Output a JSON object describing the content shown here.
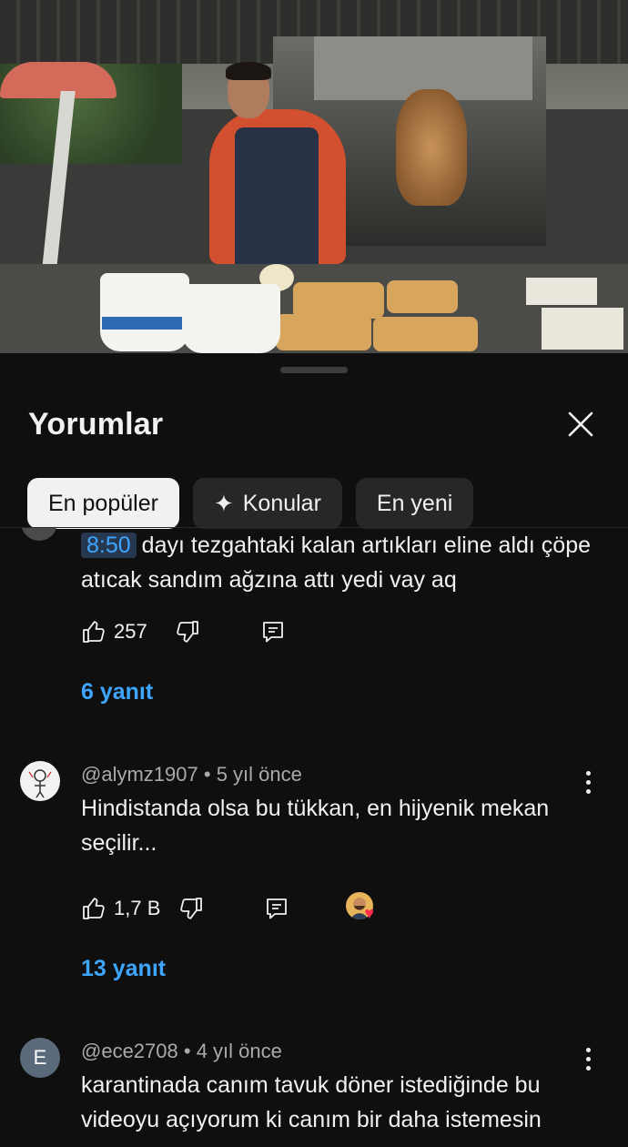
{
  "sheet": {
    "title": "Yorumlar",
    "chips": [
      {
        "label": "En popüler",
        "active": true
      },
      {
        "label": "Konular",
        "icon": "sparkle-icon"
      },
      {
        "label": "En yeni"
      }
    ]
  },
  "comments": [
    {
      "timestamp": "8:50",
      "text": "dayı tezgahtaki kalan artıkları eline aldı çöpe atıcak sandım ağzına attı yedi vay aq",
      "likes": "257",
      "replies": "6 yanıt"
    },
    {
      "author": "@alymz1907",
      "time": "5 yıl önce",
      "text": "Hindistanda olsa bu tükkan, en hijyenik mekan seçilir...",
      "likes": "1,7 B",
      "replies": "13 yanıt",
      "creator_heart": true
    },
    {
      "author": "@ece2708",
      "avatar_letter": "E",
      "time": "4 yıl önce",
      "text": "karantinada canım tavuk döner istediğinde bu videoyu açıyorum ki canım bir daha istemesin"
    }
  ],
  "colors": {
    "background": "#0f0f0f",
    "chip": "#272727",
    "chip_active": "#f1f1f1",
    "link": "#3ea6ff",
    "secondary_text": "#aaaaaa"
  }
}
